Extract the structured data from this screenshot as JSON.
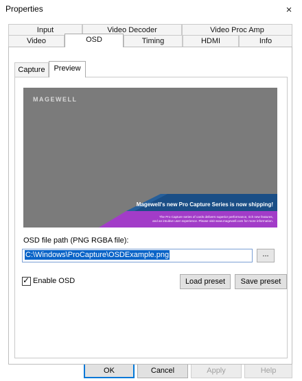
{
  "window": {
    "title": "Properties",
    "close_symbol": "×"
  },
  "tabs_row1": [
    "Input",
    "Video Decoder",
    "Video Proc Amp"
  ],
  "tabs_row2": [
    "Video",
    "OSD",
    "Timing",
    "HDMI",
    "Info"
  ],
  "selected_tab": "OSD",
  "subtabs": [
    "Capture",
    "Preview"
  ],
  "selected_subtab": "Preview",
  "preview": {
    "logo_text": "MAGEWELL",
    "banner_title": "Magewell's new Pro Capture Series is now shipping!",
    "banner_sub_line1": "The Pro Capture series of cards delivers superior performance, rich new features,",
    "banner_sub_line2": "and an intuitive user experience. Please visit www.magewell.com for more information.",
    "colors": {
      "background": "#7b7b7b",
      "banner_dark": "#1a4e86",
      "banner_purple": "#a23cc8"
    }
  },
  "osd": {
    "path_label": "OSD file path (PNG RGBA file):",
    "path_value": "C:\\Windows\\ProCapture\\OSDExample.png",
    "browse_label": "...",
    "enable_label": "Enable OSD",
    "enable_checked": true,
    "load_preset_label": "Load preset",
    "save_preset_label": "Save preset"
  },
  "buttons": {
    "ok": "OK",
    "cancel": "Cancel",
    "apply": "Apply",
    "help": "Help"
  },
  "colors": {
    "selection": "#0a64c8",
    "default_button_border": "#0078d7"
  }
}
